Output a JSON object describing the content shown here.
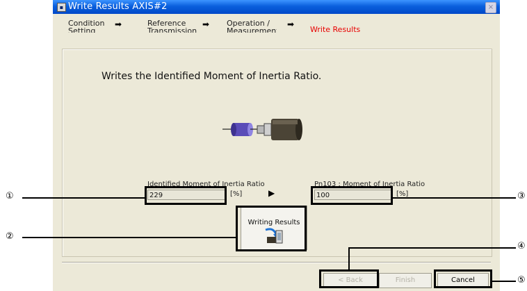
{
  "window": {
    "title": "Write Results AXIS#2",
    "icon": "app-icon",
    "close_symbol": "×"
  },
  "steps": [
    {
      "line1": "Condition",
      "line2": "Setting"
    },
    {
      "line1": "Reference",
      "line2": "Transmission"
    },
    {
      "line1": "Operation /",
      "line2": "Measurement"
    },
    {
      "line1": "Write Results",
      "line2": ""
    }
  ],
  "step_arrow": "➡",
  "heading": "Writes the Identified Moment of Inertia Ratio.",
  "identified": {
    "label": "Identified Moment of Inertia Ratio",
    "value": "229",
    "unit": "[%]"
  },
  "transfer_arrow": "▶",
  "pn103": {
    "label": "Pn103 : Moment of Inertia Ratio",
    "value": "100",
    "unit": "[%]"
  },
  "write_button": {
    "label": "Writing Results",
    "icon": "write-to-servo-icon"
  },
  "buttons": {
    "back": "< Back",
    "finish": "Finish",
    "cancel": "Cancel"
  },
  "callouts": [
    "①",
    "②",
    "③",
    "④",
    "⑤"
  ],
  "colors": {
    "titlebar": "#0a5fdd",
    "active_step": "#e80000",
    "dialog_bg": "#ece9d8"
  }
}
